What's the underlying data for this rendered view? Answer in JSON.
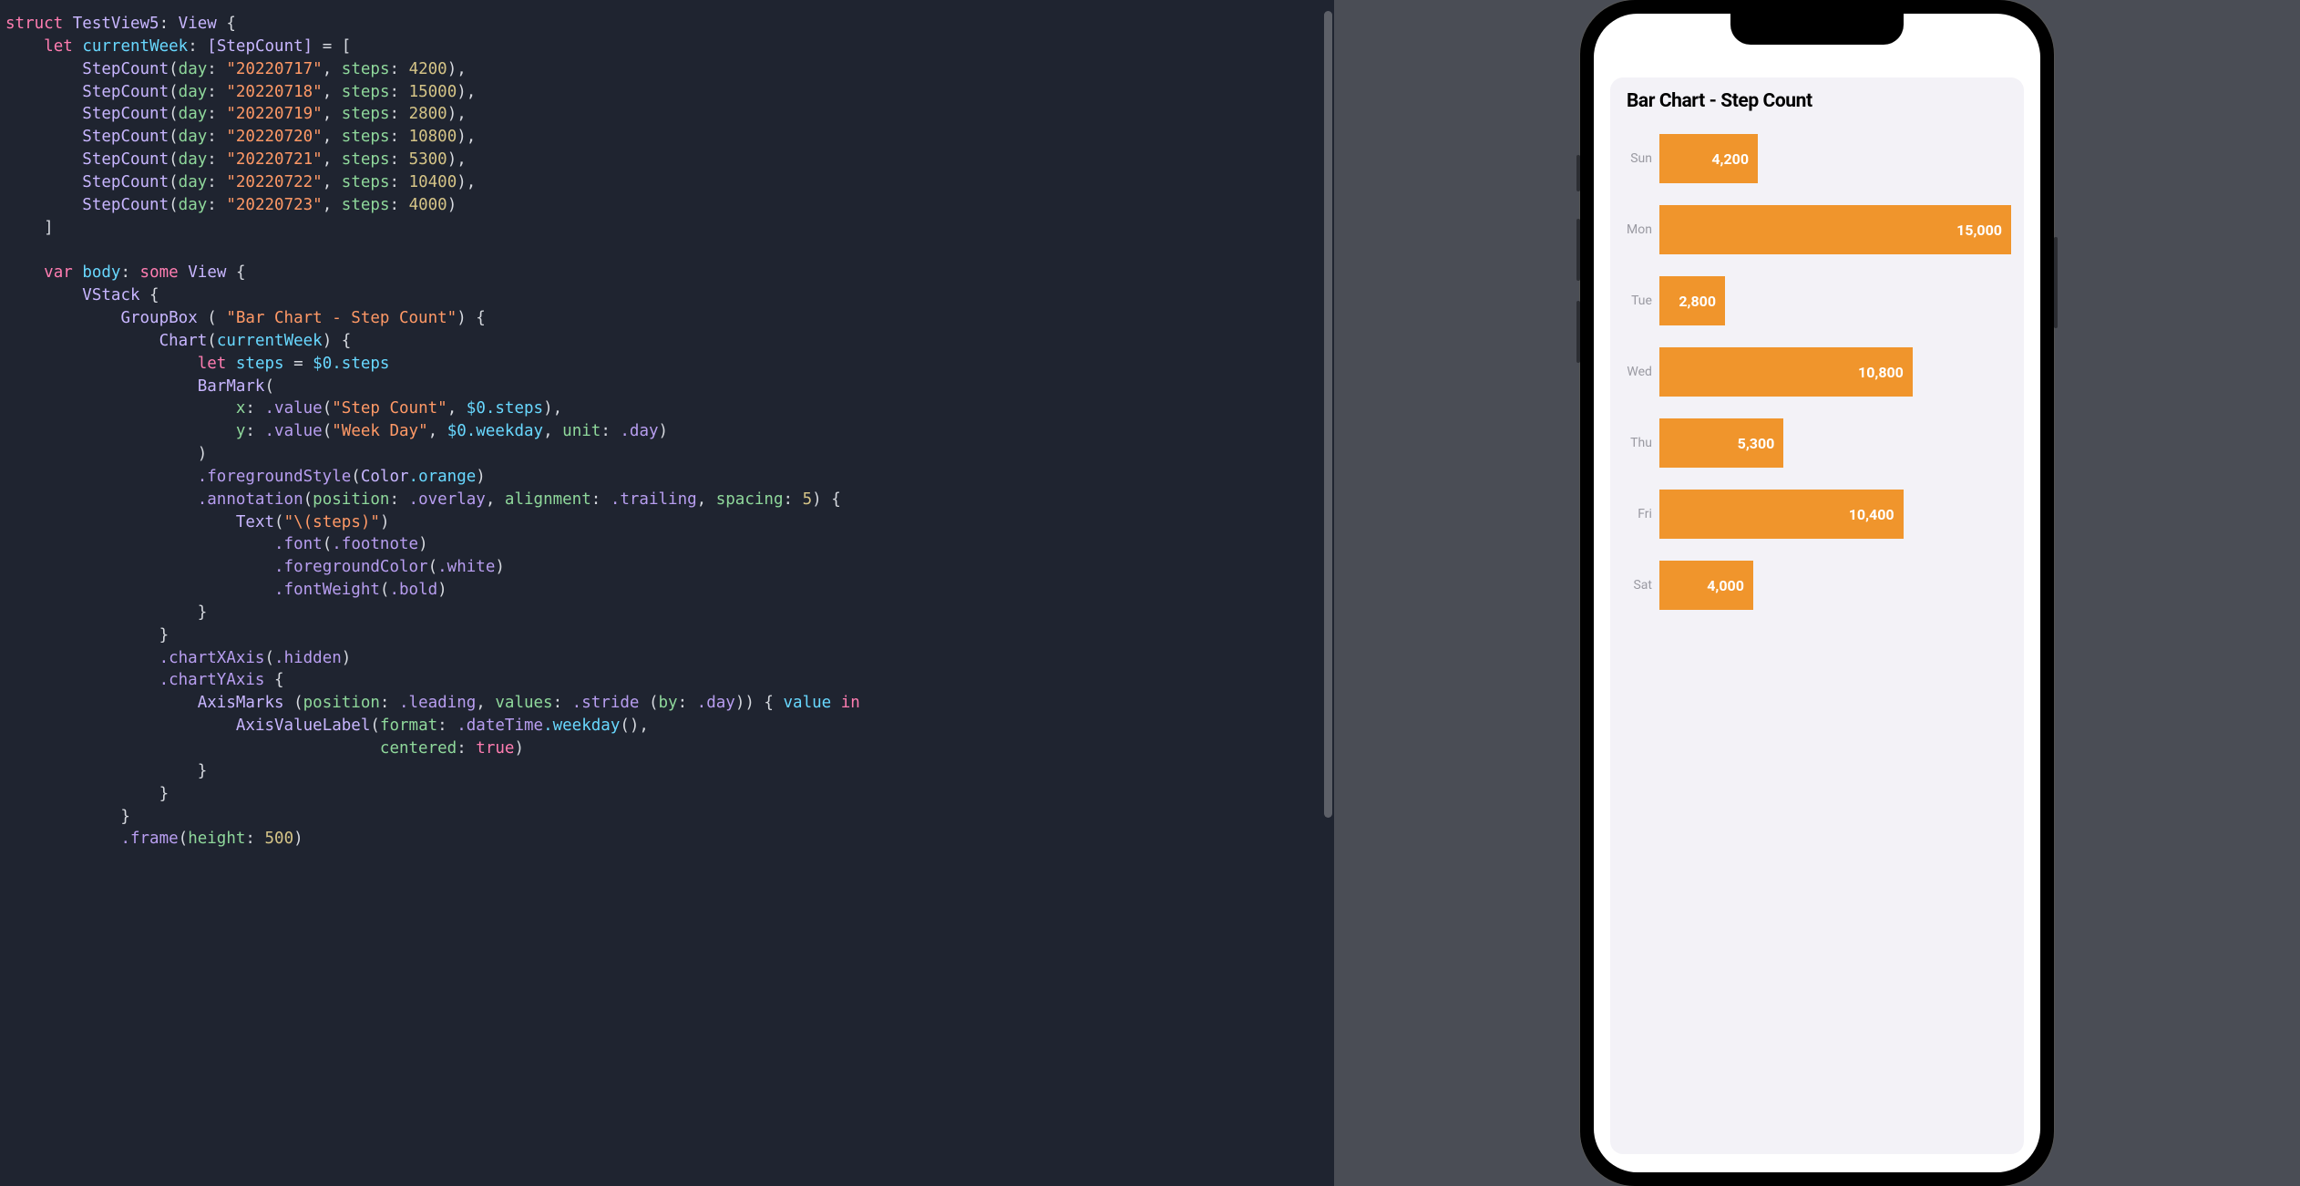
{
  "editor": {
    "struct_kw": "struct",
    "view_name": "TestView5",
    "view_proto": "View",
    "let_kw": "let",
    "var_kw": "var",
    "prop_currentWeek": "currentWeek",
    "type_stepcount_arr": "[StepCount]",
    "stepcount_ctor": "StepCount",
    "label_day": "day",
    "label_steps": "steps",
    "data_rows": [
      {
        "date": "\"20220717\"",
        "steps": "4200"
      },
      {
        "date": "\"20220718\"",
        "steps": "15000"
      },
      {
        "date": "\"20220719\"",
        "steps": "2800"
      },
      {
        "date": "\"20220720\"",
        "steps": "10800"
      },
      {
        "date": "\"20220721\"",
        "steps": "5300"
      },
      {
        "date": "\"20220722\"",
        "steps": "10400"
      },
      {
        "date": "\"20220723\"",
        "steps": "4000"
      }
    ],
    "prop_body": "body",
    "some_kw": "some",
    "vstack": "VStack",
    "groupbox": "GroupBox",
    "groupbox_title_str": "\"Bar Chart - Step Count\"",
    "chart": "Chart",
    "let_steps_line": "let",
    "steps_var": "steps",
    "dollar0": "$0",
    "dot_steps": ".steps",
    "barmark": "BarMark",
    "x_label": "x",
    "y_label": "y",
    "dot_value": ".value",
    "step_count_str": "\"Step Count\"",
    "week_day_str": "\"Week Day\"",
    "dot_weekday": ".weekday",
    "unit_label": "unit",
    "dot_day": ".day",
    "foregroundStyle": ".foregroundStyle",
    "color": "Color",
    "dot_orange": ".orange",
    "annotation": ".annotation",
    "position_label": "position",
    "dot_overlay": ".overlay",
    "alignment_label": "alignment",
    "dot_trailing": ".trailing",
    "spacing_label": "spacing",
    "spacing_val": "5",
    "text": "Text",
    "interp_steps": "\"\\(steps)\"",
    "dot_font": ".font",
    "dot_footnote": ".footnote",
    "dot_fgColor": ".foregroundColor",
    "dot_white": ".white",
    "dot_fontWeight": ".fontWeight",
    "dot_bold": ".bold",
    "chartXAxis": ".chartXAxis",
    "dot_hidden": ".hidden",
    "chartYAxis": ".chartYAxis",
    "axisMarks": "AxisMarks",
    "dot_leading": ".leading",
    "values_label": "values",
    "dot_stride": ".stride",
    "by_label": "by",
    "value_param": "value",
    "in_kw": "in",
    "axisValueLabel": "AxisValueLabel",
    "format_label": "format",
    "dot_dateTime": ".dateTime",
    "dot_weekday_call": ".weekday",
    "centered_label": "centered",
    "true_kw": "true",
    "frame_call": ".frame",
    "height_label": "height",
    "frame_height_val": "500"
  },
  "preview": {
    "groupbox_title": "Bar Chart - Step Count"
  },
  "chart_data": {
    "type": "bar",
    "orientation": "horizontal",
    "title": "Bar Chart - Step Count",
    "xlabel": "Step Count",
    "ylabel": "Week Day",
    "categories": [
      "Sun",
      "Mon",
      "Tue",
      "Wed",
      "Thu",
      "Fri",
      "Sat"
    ],
    "values": [
      4200,
      15000,
      2800,
      10800,
      5300,
      10400,
      4000
    ],
    "value_labels": [
      "4,200",
      "15,000",
      "2,800",
      "10,800",
      "5,300",
      "10,400",
      "4,000"
    ],
    "bar_color": "#f0952c",
    "xlim": [
      0,
      15000
    ]
  }
}
